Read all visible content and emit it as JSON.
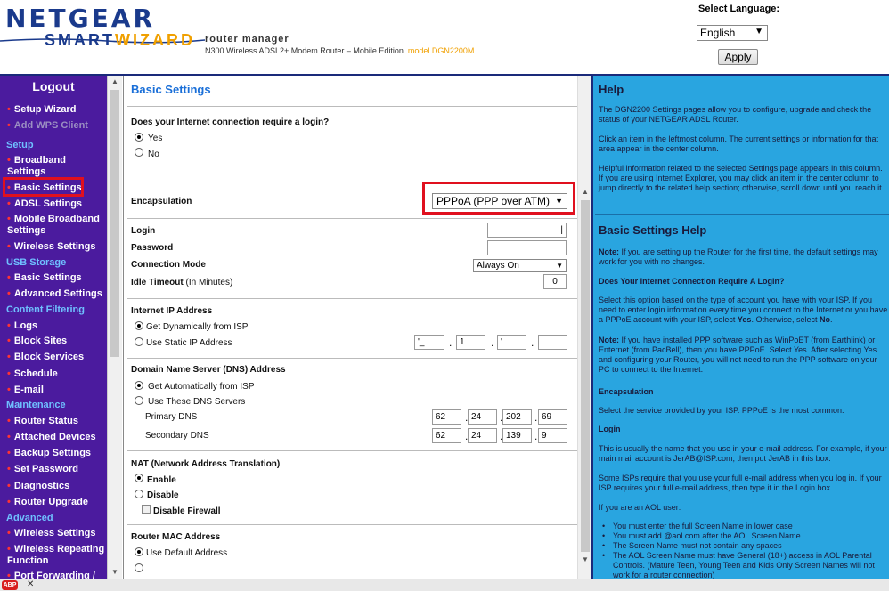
{
  "header": {
    "brand": "NETGEAR",
    "smart": "SMART",
    "wizard": "WIZARD",
    "product": "router manager",
    "subtitle": "N300 Wireless ADSL2+ Modem Router – Mobile Edition",
    "model": "model DGN2200M",
    "language_label": "Select Language:",
    "language_value": "English",
    "apply_label": "Apply"
  },
  "sidebar": {
    "logout": "Logout",
    "items": [
      {
        "label": "Setup Wizard"
      },
      {
        "label": "Add WPS Client"
      },
      {
        "section": "Setup"
      },
      {
        "label": "Broadband Settings"
      },
      {
        "label": "Basic Settings"
      },
      {
        "label": "ADSL Settings"
      },
      {
        "label": "Mobile Broadband Settings"
      },
      {
        "label": "Wireless Settings"
      },
      {
        "section": "USB Storage"
      },
      {
        "label": "Basic Settings"
      },
      {
        "label": "Advanced Settings"
      },
      {
        "section": "Content Filtering"
      },
      {
        "label": "Logs"
      },
      {
        "label": "Block Sites"
      },
      {
        "label": "Block Services"
      },
      {
        "label": "Schedule"
      },
      {
        "label": "E-mail"
      },
      {
        "section": "Maintenance"
      },
      {
        "label": "Router Status"
      },
      {
        "label": "Attached Devices"
      },
      {
        "label": "Backup Settings"
      },
      {
        "label": "Set Password"
      },
      {
        "label": "Diagnostics"
      },
      {
        "label": "Router Upgrade"
      },
      {
        "section": "Advanced"
      },
      {
        "label": "Wireless Settings"
      },
      {
        "label": "Wireless Repeating Function"
      },
      {
        "label": "Port Forwarding /"
      }
    ]
  },
  "center": {
    "title": "Basic Settings",
    "login_question": "Does your Internet connection require a login?",
    "yes": "Yes",
    "no": "No",
    "encapsulation_label": "Encapsulation",
    "encapsulation_value": "PPPoA (PPP over ATM)",
    "login_label": "Login",
    "login_value": "|",
    "password_label": "Password",
    "connection_mode_label": "Connection Mode",
    "connection_mode_value": "Always On",
    "idle_timeout_label": "Idle Timeout",
    "idle_timeout_unit": "(In Minutes)",
    "idle_timeout_value": "0",
    "internet_ip_label": "Internet IP Address",
    "get_dynamic": "Get Dynamically from ISP",
    "use_static": "Use Static IP Address",
    "static_ip": [
      "'_",
      "1",
      "'",
      ""
    ],
    "dns_label": "Domain Name Server (DNS) Address",
    "dns_auto": "Get Automatically from ISP",
    "dns_manual": "Use These DNS Servers",
    "primary_dns_label": "Primary DNS",
    "primary_dns": [
      "62",
      "24",
      "202",
      "69"
    ],
    "secondary_dns_label": "Secondary DNS",
    "secondary_dns": [
      "62",
      "24",
      "139",
      "9"
    ],
    "nat_label": "NAT (Network Address Translation)",
    "nat_enable": "Enable",
    "nat_disable": "Disable",
    "disable_firewall": "Disable Firewall",
    "mac_label": "Router MAC Address",
    "mac_default": "Use Default Address"
  },
  "help": {
    "title": "Help",
    "intro1": "The DGN2200 Settings pages allow you to configure, upgrade and check the status of your NETGEAR ADSL Router.",
    "intro2": "Click an item in the leftmost column. The current settings or information for that area appear in the center column.",
    "intro3": "Helpful information related to the selected Settings page appears in this column. If you are using Internet Explorer, you may click an item in the center column to jump directly to the related help section; otherwise, scroll down until you reach it.",
    "basic_title": "Basic Settings Help",
    "note1_b": "Note:",
    "note1": " If you are setting up the Router for the first time, the default settings may work for you with no changes.",
    "q_login": "Does Your Internet Connection Require A Login?",
    "login_para_1": "Select this option based on the type of account you have with your ISP. If you need to enter login information every time you connect to the Internet or you have a PPPoE account with your ISP, select ",
    "login_para_yes": "Yes",
    "login_para_2": ". Otherwise, select ",
    "login_para_no": "No",
    "login_para_3": ".",
    "note2_b": "Note:",
    "note2": " If you have installed PPP software such as WinPoET (from Earthlink) or Enternet (from PacBell), then you have PPPoE. Select Yes. After selecting Yes and configuring your Router, you will not need to run the PPP software on your PC to connect to the Internet.",
    "enc_title": "Encapsulation",
    "enc_para": "Select the service provided by your ISP. PPPoE is the most common.",
    "login_title": "Login",
    "login_help1": "This is usually the name that you use in your e-mail address. For example, if your main mail account is JerAB@ISP.com, then put JerAB in this box.",
    "login_help2": "Some ISPs require that you use your full e-mail address when you log in. If your ISP requires your full e-mail address, then type it in the Login box.",
    "aol_intro": "If you are an AOL user:",
    "aol_list": [
      "You must enter the full Screen Name in lower case",
      "You must add @aol.com after the AOL Screen Name",
      "The Screen Name must not contain any spaces",
      "The AOL Screen Name must have General (18+) access in AOL Parental Controls. (Mature Teen, Young Teen and Kids Only Screen Names will not work for a router connection)"
    ]
  },
  "bottombar": {
    "badge": "ABP",
    "close": "✕"
  },
  "colors": {
    "sidebar_bg": "#4b1b9e",
    "section_text": "#6fc0ff",
    "help_bg": "#29a5e0",
    "title_blue": "#1a6fd8",
    "highlight_red": "#e0101e"
  }
}
